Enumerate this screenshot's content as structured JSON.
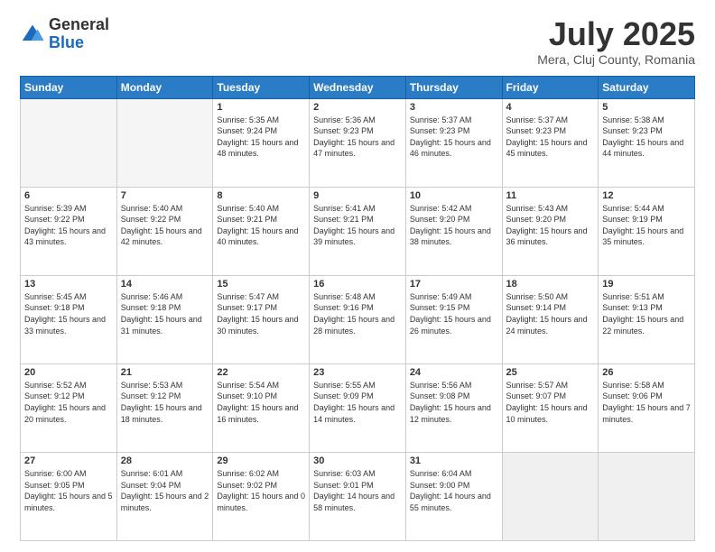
{
  "logo": {
    "general": "General",
    "blue": "Blue"
  },
  "title": "July 2025",
  "location": "Mera, Cluj County, Romania",
  "days_of_week": [
    "Sunday",
    "Monday",
    "Tuesday",
    "Wednesday",
    "Thursday",
    "Friday",
    "Saturday"
  ],
  "weeks": [
    [
      {
        "day": "",
        "empty": true
      },
      {
        "day": "",
        "empty": true
      },
      {
        "day": "1",
        "sunrise": "5:35 AM",
        "sunset": "9:24 PM",
        "daylight": "15 hours and 48 minutes."
      },
      {
        "day": "2",
        "sunrise": "5:36 AM",
        "sunset": "9:23 PM",
        "daylight": "15 hours and 47 minutes."
      },
      {
        "day": "3",
        "sunrise": "5:37 AM",
        "sunset": "9:23 PM",
        "daylight": "15 hours and 46 minutes."
      },
      {
        "day": "4",
        "sunrise": "5:37 AM",
        "sunset": "9:23 PM",
        "daylight": "15 hours and 45 minutes."
      },
      {
        "day": "5",
        "sunrise": "5:38 AM",
        "sunset": "9:23 PM",
        "daylight": "15 hours and 44 minutes."
      }
    ],
    [
      {
        "day": "6",
        "sunrise": "5:39 AM",
        "sunset": "9:22 PM",
        "daylight": "15 hours and 43 minutes."
      },
      {
        "day": "7",
        "sunrise": "5:40 AM",
        "sunset": "9:22 PM",
        "daylight": "15 hours and 42 minutes."
      },
      {
        "day": "8",
        "sunrise": "5:40 AM",
        "sunset": "9:21 PM",
        "daylight": "15 hours and 40 minutes."
      },
      {
        "day": "9",
        "sunrise": "5:41 AM",
        "sunset": "9:21 PM",
        "daylight": "15 hours and 39 minutes."
      },
      {
        "day": "10",
        "sunrise": "5:42 AM",
        "sunset": "9:20 PM",
        "daylight": "15 hours and 38 minutes."
      },
      {
        "day": "11",
        "sunrise": "5:43 AM",
        "sunset": "9:20 PM",
        "daylight": "15 hours and 36 minutes."
      },
      {
        "day": "12",
        "sunrise": "5:44 AM",
        "sunset": "9:19 PM",
        "daylight": "15 hours and 35 minutes."
      }
    ],
    [
      {
        "day": "13",
        "sunrise": "5:45 AM",
        "sunset": "9:18 PM",
        "daylight": "15 hours and 33 minutes."
      },
      {
        "day": "14",
        "sunrise": "5:46 AM",
        "sunset": "9:18 PM",
        "daylight": "15 hours and 31 minutes."
      },
      {
        "day": "15",
        "sunrise": "5:47 AM",
        "sunset": "9:17 PM",
        "daylight": "15 hours and 30 minutes."
      },
      {
        "day": "16",
        "sunrise": "5:48 AM",
        "sunset": "9:16 PM",
        "daylight": "15 hours and 28 minutes."
      },
      {
        "day": "17",
        "sunrise": "5:49 AM",
        "sunset": "9:15 PM",
        "daylight": "15 hours and 26 minutes."
      },
      {
        "day": "18",
        "sunrise": "5:50 AM",
        "sunset": "9:14 PM",
        "daylight": "15 hours and 24 minutes."
      },
      {
        "day": "19",
        "sunrise": "5:51 AM",
        "sunset": "9:13 PM",
        "daylight": "15 hours and 22 minutes."
      }
    ],
    [
      {
        "day": "20",
        "sunrise": "5:52 AM",
        "sunset": "9:12 PM",
        "daylight": "15 hours and 20 minutes."
      },
      {
        "day": "21",
        "sunrise": "5:53 AM",
        "sunset": "9:12 PM",
        "daylight": "15 hours and 18 minutes."
      },
      {
        "day": "22",
        "sunrise": "5:54 AM",
        "sunset": "9:10 PM",
        "daylight": "15 hours and 16 minutes."
      },
      {
        "day": "23",
        "sunrise": "5:55 AM",
        "sunset": "9:09 PM",
        "daylight": "15 hours and 14 minutes."
      },
      {
        "day": "24",
        "sunrise": "5:56 AM",
        "sunset": "9:08 PM",
        "daylight": "15 hours and 12 minutes."
      },
      {
        "day": "25",
        "sunrise": "5:57 AM",
        "sunset": "9:07 PM",
        "daylight": "15 hours and 10 minutes."
      },
      {
        "day": "26",
        "sunrise": "5:58 AM",
        "sunset": "9:06 PM",
        "daylight": "15 hours and 7 minutes."
      }
    ],
    [
      {
        "day": "27",
        "sunrise": "6:00 AM",
        "sunset": "9:05 PM",
        "daylight": "15 hours and 5 minutes."
      },
      {
        "day": "28",
        "sunrise": "6:01 AM",
        "sunset": "9:04 PM",
        "daylight": "15 hours and 2 minutes."
      },
      {
        "day": "29",
        "sunrise": "6:02 AM",
        "sunset": "9:02 PM",
        "daylight": "15 hours and 0 minutes."
      },
      {
        "day": "30",
        "sunrise": "6:03 AM",
        "sunset": "9:01 PM",
        "daylight": "14 hours and 58 minutes."
      },
      {
        "day": "31",
        "sunrise": "6:04 AM",
        "sunset": "9:00 PM",
        "daylight": "14 hours and 55 minutes."
      },
      {
        "day": "",
        "empty": true
      },
      {
        "day": "",
        "empty": true
      }
    ]
  ]
}
